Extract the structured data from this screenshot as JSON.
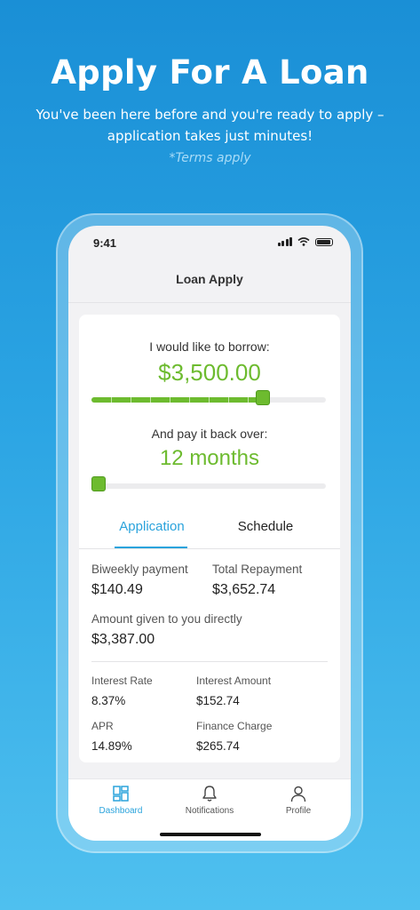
{
  "hero": {
    "title": "Apply For A Loan",
    "subtitle": "You've been here before and you're ready to apply – application takes just minutes!",
    "terms": "*Terms apply"
  },
  "status_bar": {
    "time": "9:41"
  },
  "nav": {
    "title": "Loan Apply"
  },
  "borrow": {
    "label": "I would like to borrow:",
    "amount": "$3,500.00",
    "slider_fraction": 0.73
  },
  "payback": {
    "label": "And pay it back over:",
    "term": "12 months",
    "slider_fraction": 0.0
  },
  "tabs": [
    {
      "label": "Application",
      "active": true
    },
    {
      "label": "Schedule",
      "active": false
    }
  ],
  "summary": {
    "biweekly_label": "Biweekly payment",
    "biweekly_value": "$140.49",
    "total_label": "Total Repayment",
    "total_value": "$3,652.74",
    "direct_label": "Amount given to you directly",
    "direct_value": "$3,387.00"
  },
  "details": {
    "interest_rate_label": "Interest Rate",
    "interest_rate_value": "8.37%",
    "interest_amount_label": "Interest Amount",
    "interest_amount_value": "$152.74",
    "apr_label": "APR",
    "apr_value": "14.89%",
    "finance_label": "Finance Charge",
    "finance_value": "$265.74"
  },
  "tabbar": [
    {
      "label": "Dashboard",
      "icon": "dashboard-icon",
      "active": true
    },
    {
      "label": "Notifications",
      "icon": "bell-icon",
      "active": false
    },
    {
      "label": "Profile",
      "icon": "user-icon",
      "active": false
    }
  ],
  "colors": {
    "accent_green": "#6dbb2f",
    "accent_blue": "#2aa3dc",
    "background_top": "#1a8fd6",
    "background_bottom": "#4fc0ef"
  }
}
